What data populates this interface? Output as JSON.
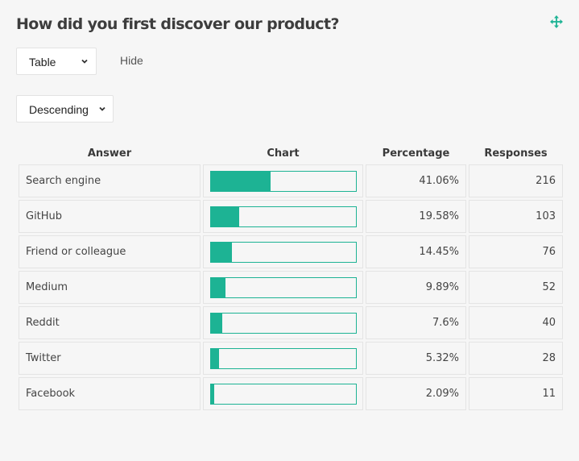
{
  "header": {
    "title": "How did you first discover our product?",
    "move_icon": "move-arrows-icon"
  },
  "controls": {
    "view_select": {
      "value": "Table"
    },
    "hide_label": "Hide",
    "sort_select": {
      "value": "Descending"
    }
  },
  "colors": {
    "accent": "#1db394"
  },
  "table": {
    "columns": [
      "Answer",
      "Chart",
      "Percentage",
      "Responses"
    ],
    "rows": [
      {
        "answer": "Search engine",
        "percentage": "41.06%",
        "fraction": 0.4106,
        "responses": "216"
      },
      {
        "answer": "GitHub",
        "percentage": "19.58%",
        "fraction": 0.1958,
        "responses": "103"
      },
      {
        "answer": "Friend or colleague",
        "percentage": "14.45%",
        "fraction": 0.1445,
        "responses": "76"
      },
      {
        "answer": "Medium",
        "percentage": "9.89%",
        "fraction": 0.0989,
        "responses": "52"
      },
      {
        "answer": "Reddit",
        "percentage": "7.6%",
        "fraction": 0.076,
        "responses": "40"
      },
      {
        "answer": "Twitter",
        "percentage": "5.32%",
        "fraction": 0.0532,
        "responses": "28"
      },
      {
        "answer": "Facebook",
        "percentage": "2.09%",
        "fraction": 0.0209,
        "responses": "11"
      }
    ]
  }
}
